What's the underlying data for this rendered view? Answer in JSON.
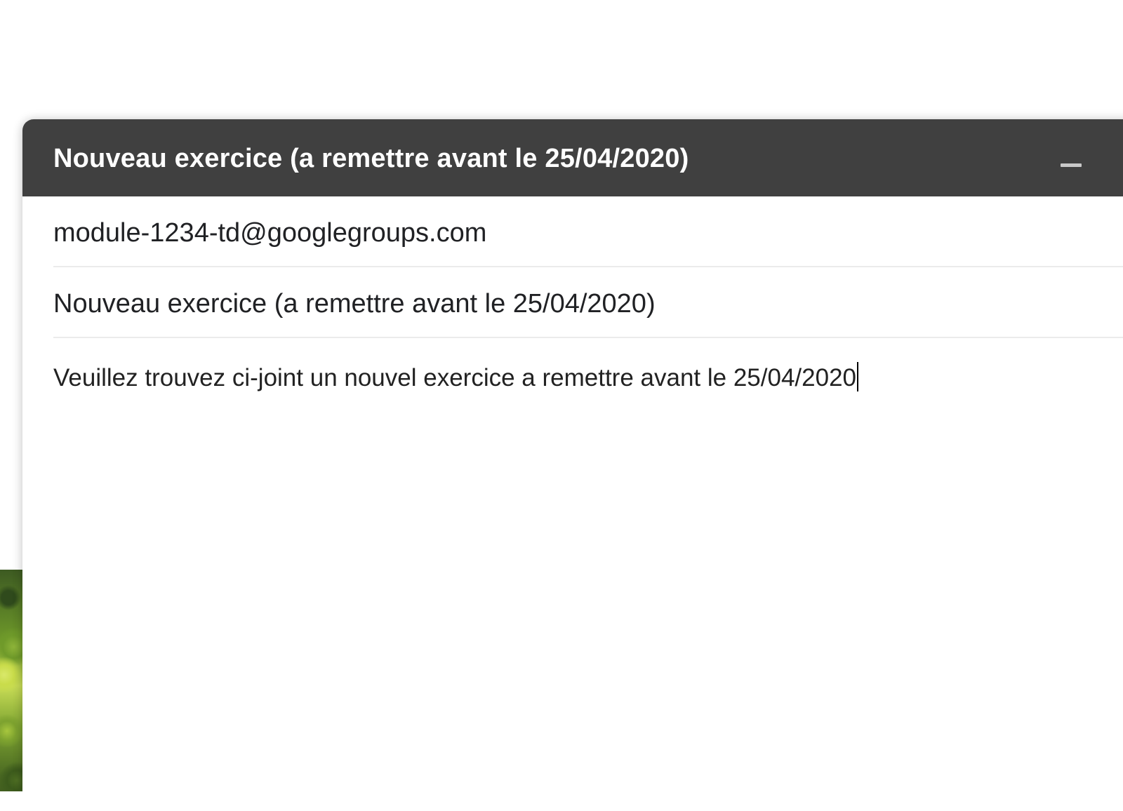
{
  "compose": {
    "title": "Nouveau exercice (a remettre avant le 25/04/2020)",
    "to": "module-1234-td@googlegroups.com",
    "subject": "Nouveau exercice (a remettre avant le 25/04/2020)",
    "body": "Veuillez trouvez ci-joint un nouvel exercice a remettre avant le 25/04/2020"
  },
  "icons": {
    "minimize": "minimize-icon"
  },
  "colors": {
    "header_bg": "#404040",
    "header_text": "#ffffff",
    "divider": "#ebebeb"
  }
}
